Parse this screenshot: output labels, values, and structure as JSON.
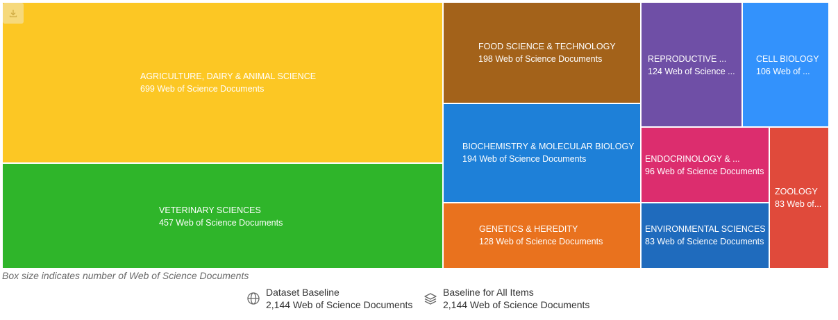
{
  "chart_data": {
    "type": "treemap",
    "value_unit": "Web of Science Documents",
    "items": [
      {
        "name": "AGRICULTURE, DAIRY & ANIMAL SCIENCE",
        "value": 699,
        "label": "699 Web of Science Documents",
        "color": "#fcc724"
      },
      {
        "name": "VETERINARY SCIENCES",
        "value": 457,
        "label": "457 Web of Science Documents",
        "color": "#2fb52a"
      },
      {
        "name": "FOOD SCIENCE & TECHNOLOGY",
        "value": 198,
        "label": "198 Web of Science Documents",
        "color": "#a3621a"
      },
      {
        "name": "BIOCHEMISTRY & MOLECULAR BIOLOGY",
        "value": 194,
        "label": "194 Web of Science Documents",
        "color": "#1e80d8"
      },
      {
        "name": "GENETICS & HEREDITY",
        "value": 128,
        "label": "128 Web of Science Documents",
        "color": "#e9721e"
      },
      {
        "name": "REPRODUCTIVE ...",
        "value": 124,
        "label": "124 Web of Science ...",
        "color": "#6f4fa6"
      },
      {
        "name": "CELL BIOLOGY",
        "value": 106,
        "label": "106 Web of ...",
        "color": "#3392fc"
      },
      {
        "name": "ENDOCRINOLOGY & ...",
        "value": 96,
        "label": "96 Web of Science Documents",
        "color": "#dc2d6e"
      },
      {
        "name": "ZOOLOGY",
        "value": 83,
        "label": "83 Web of...",
        "color": "#e04a3b"
      },
      {
        "name": "ENVIRONMENTAL SCIENCES",
        "value": 83,
        "label": "83 Web of Science Documents",
        "color": "#1f6bbd"
      }
    ]
  },
  "caption": "Box size indicates number of Web of Science Documents",
  "baselines": [
    {
      "title": "Dataset Baseline",
      "value": "2,144 Web of Science Documents",
      "icon": "globe-icon"
    },
    {
      "title": "Baseline for All Items",
      "value": "2,144 Web of Science Documents",
      "icon": "layers-icon"
    }
  ],
  "download_icon": "download-icon"
}
